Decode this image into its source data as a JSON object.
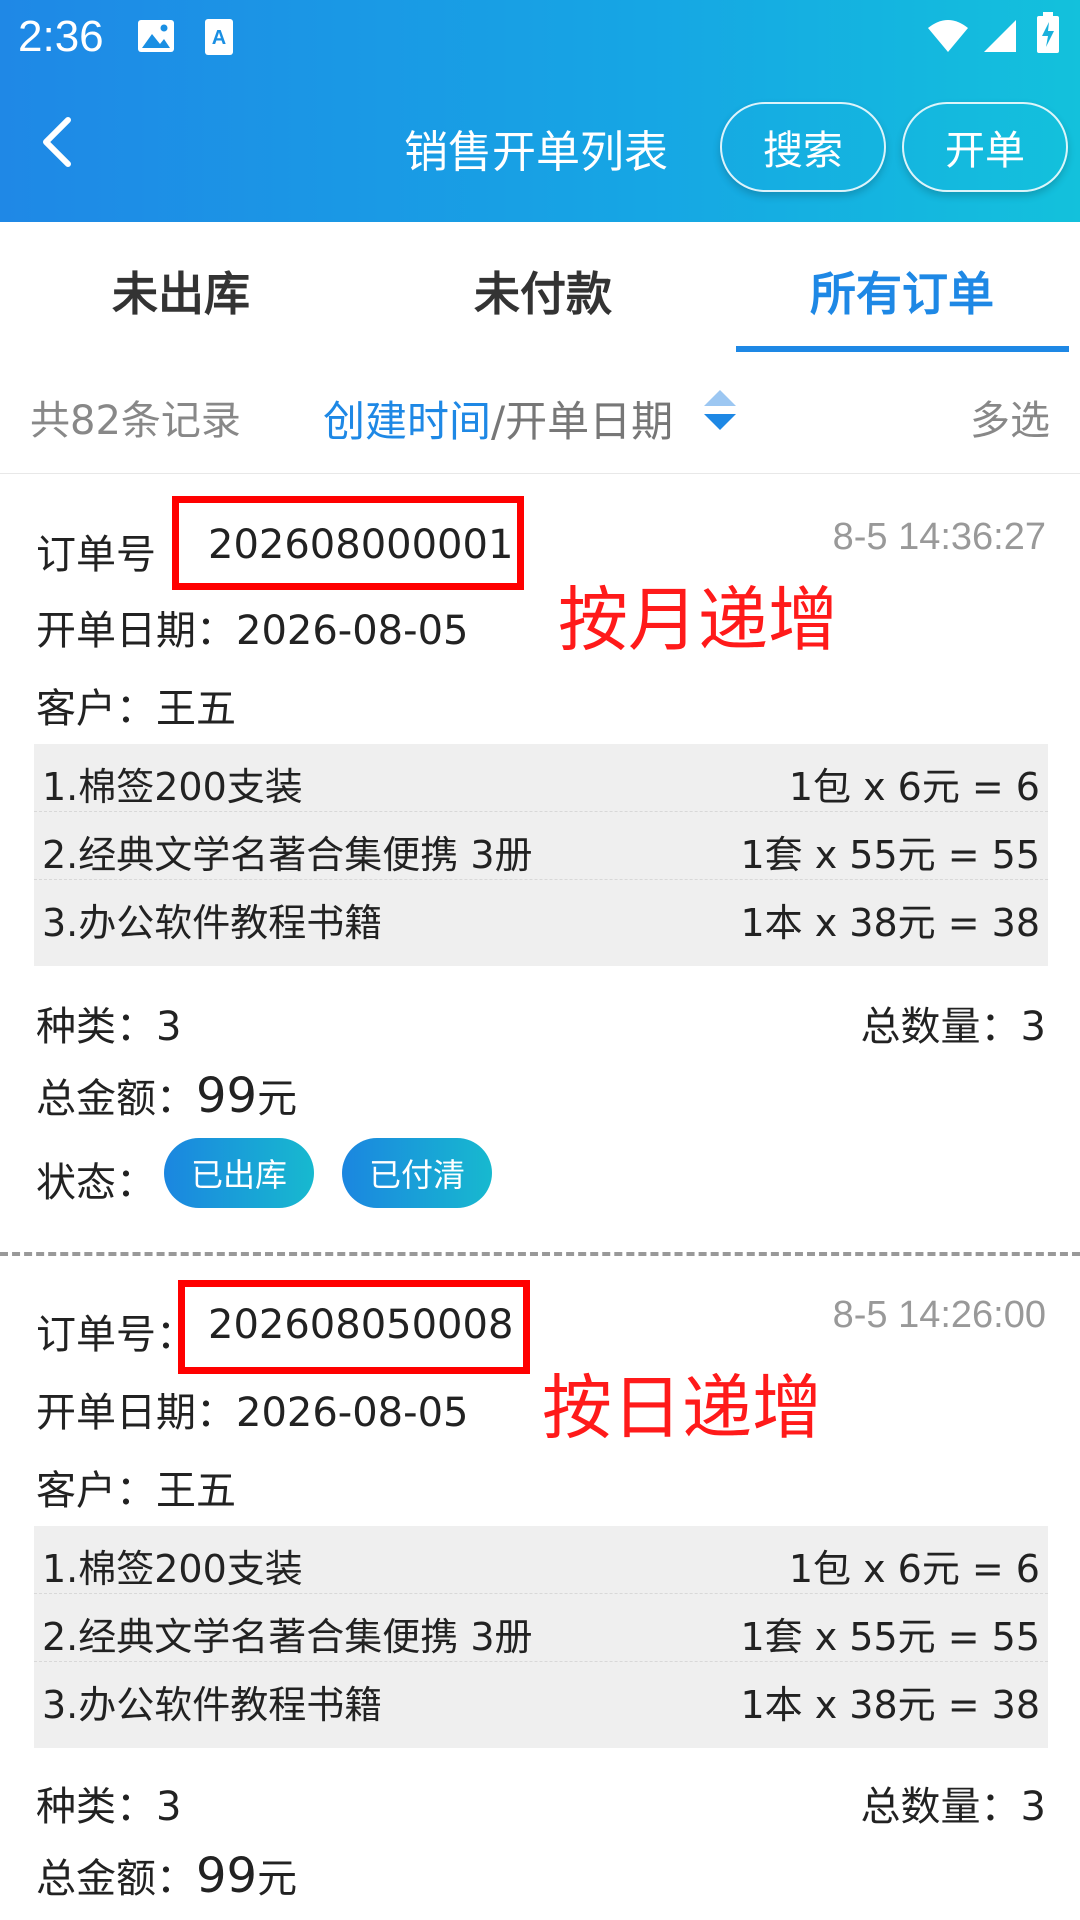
{
  "status_bar": {
    "time": "2:36"
  },
  "header": {
    "title": "销售开单列表",
    "search_label": "搜索",
    "create_label": "开单"
  },
  "tabs": [
    {
      "label": "未出库"
    },
    {
      "label": "未付款"
    },
    {
      "label": "所有订单"
    }
  ],
  "active_tab": "所有订单",
  "filter": {
    "records": "共82条记录",
    "sort_active": "创建时间",
    "sort_rest": "/开单日期",
    "multi_select": "多选"
  },
  "orders": [
    {
      "order_label": "订单号",
      "order_no": "202608000001",
      "created": "8-5 14:36:27",
      "annotation": "按月递增",
      "date_label": "开单日期：",
      "date": "2026-08-05",
      "customer_label": "客户：",
      "customer": "王五",
      "items": [
        {
          "name": "1.棉签200支装",
          "calc": "1包 x 6元 = 6"
        },
        {
          "name": "2.经典文学名著合集便携 3册",
          "calc": "1套 x 55元 = 55"
        },
        {
          "name": "3.办公软件教程书籍",
          "calc": "1本 x 38元 = 38"
        }
      ],
      "kinds_label": "种类：",
      "kinds": "3",
      "qty_label": "总数量：",
      "qty": "3",
      "amount_label": "总金额：",
      "amount": "99",
      "amount_unit": "元",
      "status_label": "状态：",
      "status_badges": [
        "已出库",
        "已付清"
      ]
    },
    {
      "order_label": "订单号：",
      "order_no": "202608050008",
      "created": "8-5 14:26:00",
      "annotation": "按日递增",
      "date_label": "开单日期：",
      "date": "2026-08-05",
      "customer_label": "客户：",
      "customer": "王五",
      "items": [
        {
          "name": "1.棉签200支装",
          "calc": "1包 x 6元 = 6"
        },
        {
          "name": "2.经典文学名著合集便携 3册",
          "calc": "1套 x 55元 = 55"
        },
        {
          "name": "3.办公软件教程书籍",
          "calc": "1本 x 38元 = 38"
        }
      ],
      "kinds_label": "种类：",
      "kinds": "3",
      "qty_label": "总数量：",
      "qty": "3",
      "amount_label": "总金额：",
      "amount": "99",
      "amount_unit": "元"
    }
  ],
  "colors": {
    "accent": "#1e88e5",
    "annotation_red": "#ff0000"
  }
}
